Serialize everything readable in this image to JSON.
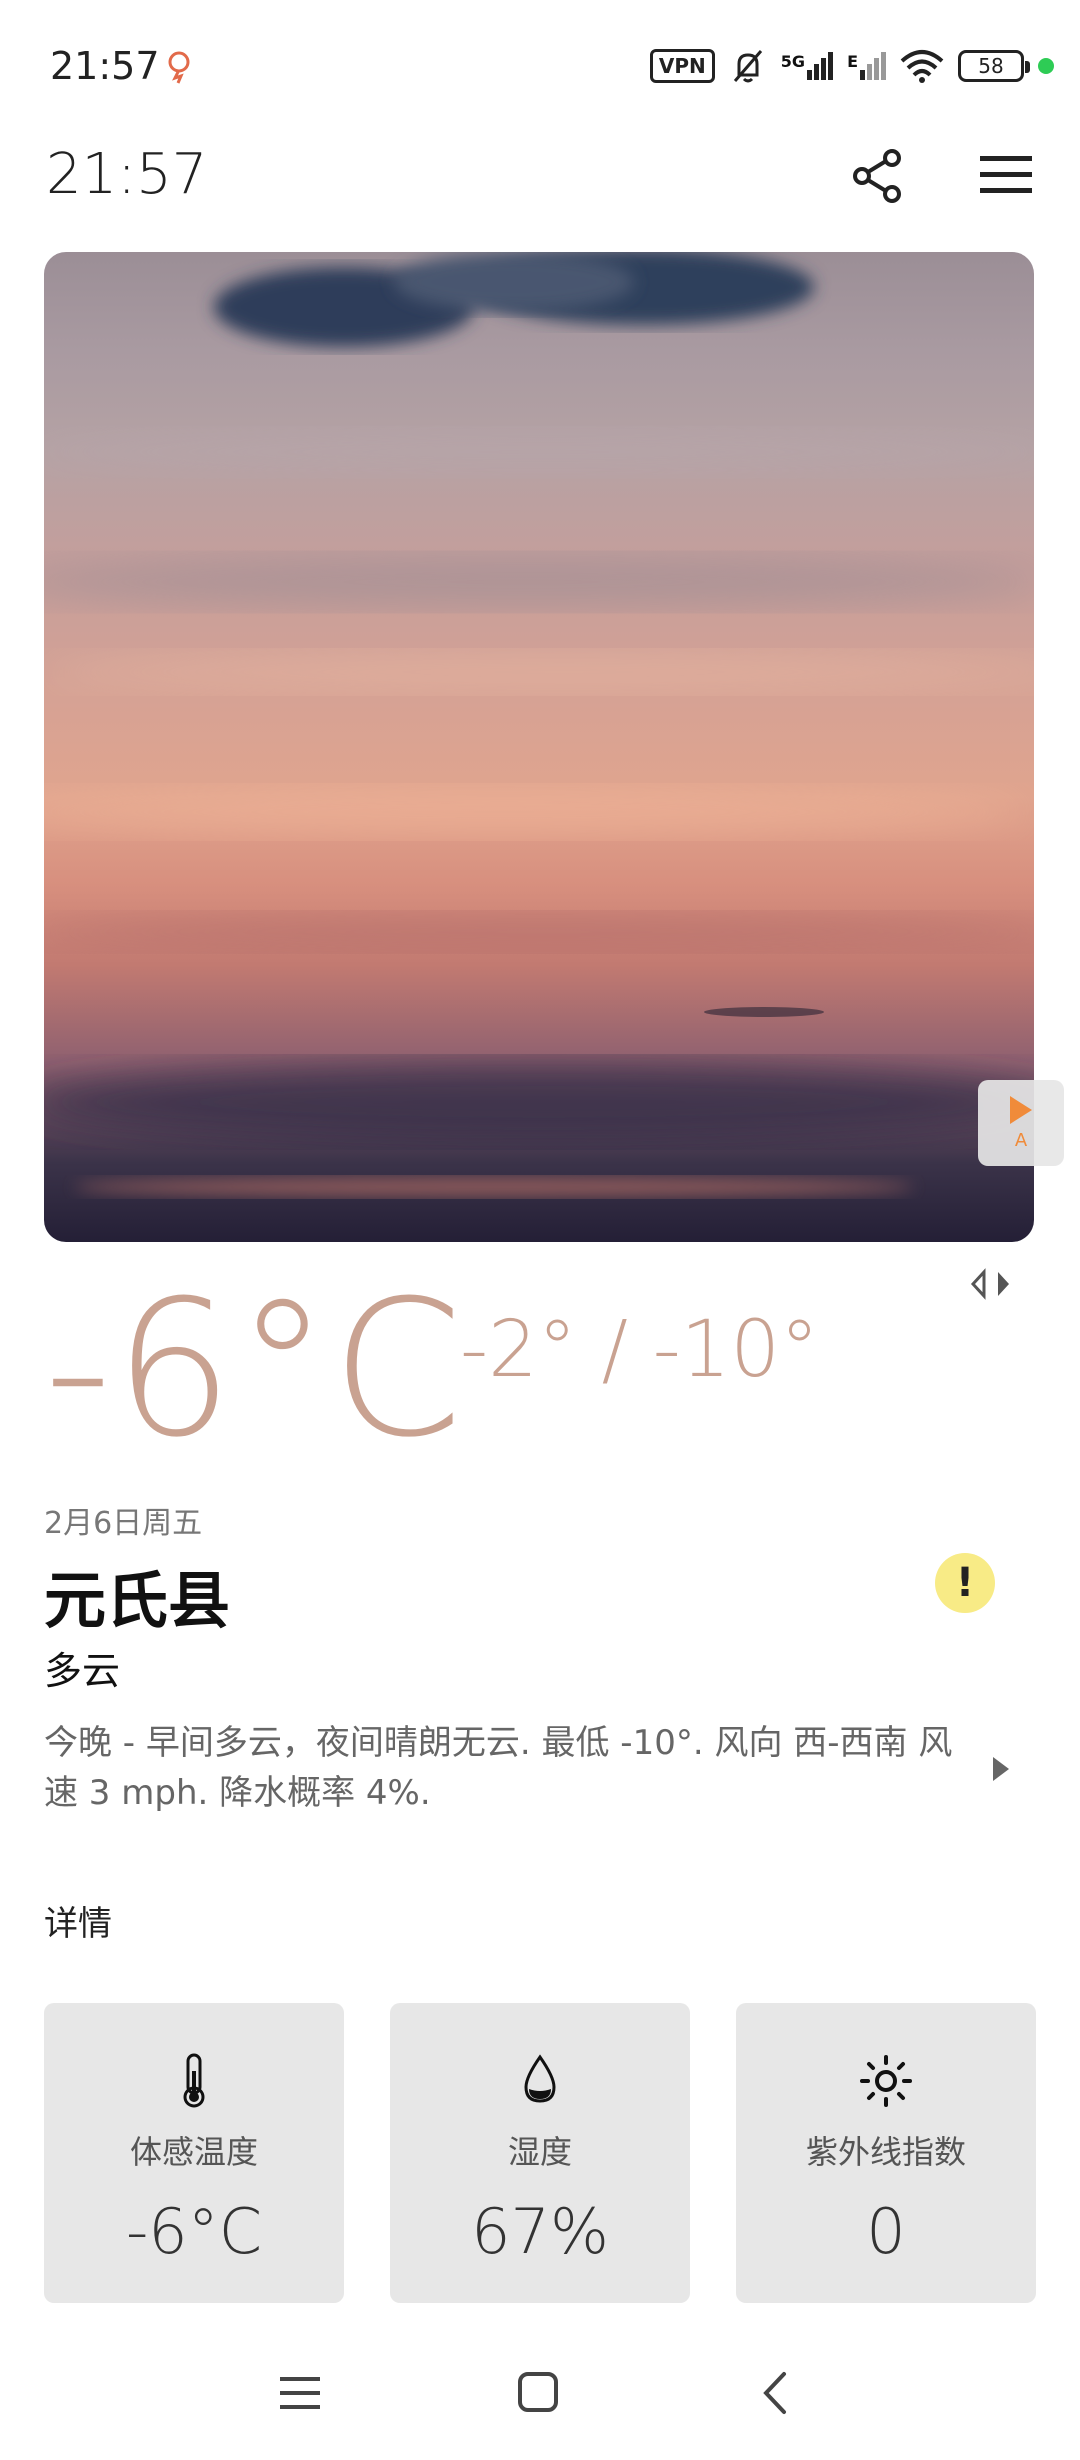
{
  "status_bar": {
    "time": "21:57",
    "vpn": "VPN",
    "network": "5G",
    "network2": "E",
    "battery": "58",
    "dot_color": "#2ecc55"
  },
  "header": {
    "time": "21:57",
    "share_icon": "share-icon",
    "menu_icon": "hamburger-menu-icon"
  },
  "hero": {
    "play_label": "A",
    "accent": "#f08b3a"
  },
  "weather": {
    "temperature": "-6°C",
    "range": "-2° / -10°",
    "date": "2月6日周五",
    "location": "元氏县",
    "condition": "多云",
    "alert_symbol": "!",
    "summary": "今晚 - 早间多云，夜间晴朗无云. 最低 -10°. 风向 西-西南 风速 3 mph. 降水概率 4%.",
    "temp_color": "#c9a291"
  },
  "details": {
    "title": "详情",
    "cards": [
      {
        "icon": "thermometer-icon",
        "label": "体感温度",
        "value": "-6°C"
      },
      {
        "icon": "water-drop-icon",
        "label": "湿度",
        "value": "67%"
      },
      {
        "icon": "sun-icon",
        "label": "紫外线指数",
        "value": "0"
      }
    ]
  },
  "nav": {
    "menu_icon": "nav-menu-icon",
    "home_icon": "nav-home-icon",
    "back_icon": "nav-back-icon"
  }
}
